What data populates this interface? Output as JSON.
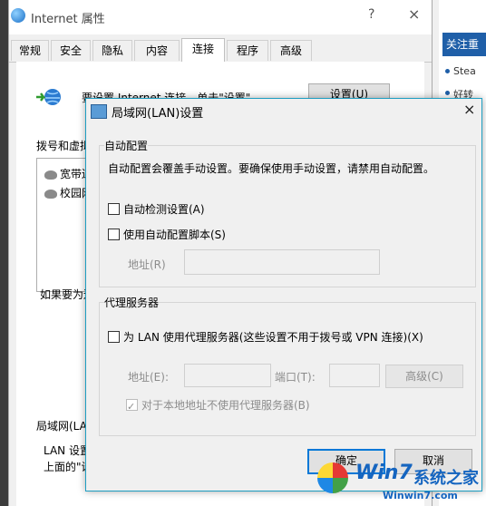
{
  "background": {
    "right_panel": {
      "header": "关注重",
      "items": [
        "Stea",
        "好转"
      ]
    }
  },
  "internet_properties": {
    "title": "Internet 属性",
    "help": "?",
    "close": "×",
    "tabs": [
      {
        "label": "常规"
      },
      {
        "label": "安全"
      },
      {
        "label": "隐私"
      },
      {
        "label": "内容"
      },
      {
        "label": "连接",
        "active": true
      },
      {
        "label": "程序"
      },
      {
        "label": "高级"
      }
    ],
    "setup_text": "要设置 Internet 连接，单击\"设置\"。",
    "setup_button": "设置(U)",
    "dialup_label": "拨号和虚拟专用网络设置",
    "connections": [
      "宽带连",
      "校园网"
    ],
    "if_proxy_text": "如果要为连",
    "lan_section_label": "局域网(LAN",
    "lan_text_1": "LAN 设置不",
    "lan_text_2": "上面的\"设"
  },
  "lan_dialog": {
    "title": "局域网(LAN)设置",
    "close": "×",
    "auto_config": {
      "label": "自动配置",
      "description": "自动配置会覆盖手动设置。要确保使用手动设置，请禁用自动配置。",
      "auto_detect": {
        "label": "自动检测设置(A)",
        "checked": false
      },
      "use_script": {
        "label": "使用自动配置脚本(S)",
        "checked": false
      },
      "address_label": "地址(R)",
      "address_value": ""
    },
    "proxy": {
      "label": "代理服务器",
      "use_proxy": {
        "label": "为 LAN 使用代理服务器(这些设置不用于拨号或 VPN 连接)(X)",
        "checked": false
      },
      "address_label": "地址(E):",
      "address_value": "",
      "port_label": "端口(T):",
      "port_value": "",
      "advanced_button": "高级(C)",
      "bypass_local": {
        "label": "对于本地地址不使用代理服务器(B)",
        "checked": true,
        "enabled": false
      }
    },
    "ok_button": "确定",
    "cancel_button": "取消"
  },
  "watermark": {
    "brand": "Win7",
    "brand_suffix": "系统之家",
    "url": "Winwin7.com"
  },
  "colors": {
    "accent": "#0078d7",
    "dialog_border": "#1e9ec2",
    "right_header": "#1f5fa8"
  }
}
